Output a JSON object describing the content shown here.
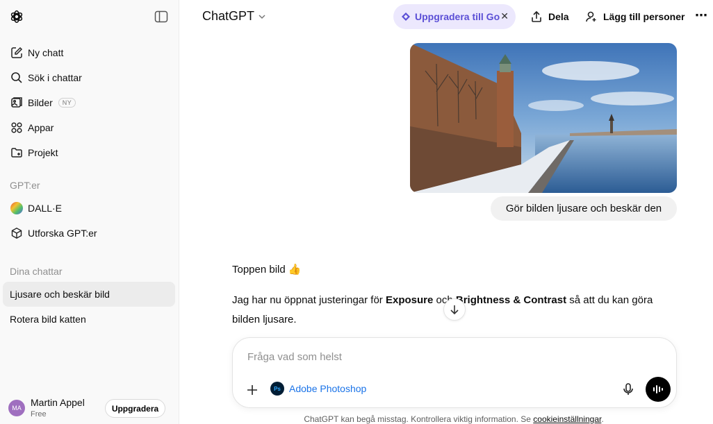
{
  "sidebar": {
    "items": [
      {
        "label": "Ny chatt",
        "icon": "new-chat-icon"
      },
      {
        "label": "Sök i chattar",
        "icon": "search-icon"
      },
      {
        "label": "Bilder",
        "icon": "images-icon",
        "badge": "NY"
      },
      {
        "label": "Appar",
        "icon": "apps-icon"
      },
      {
        "label": "Projekt",
        "icon": "folder-plus-icon"
      }
    ],
    "gpts_heading": "GPT:er",
    "gpts": [
      {
        "label": "DALL·E",
        "icon": "dalle-icon"
      },
      {
        "label": "Utforska GPT:er",
        "icon": "cube-icon"
      }
    ],
    "chats_heading": "Dina chattar",
    "chats": [
      {
        "label": "Ljusare och beskär bild",
        "active": true
      },
      {
        "label": "Rotera bild katten",
        "active": false
      }
    ],
    "user": {
      "initials": "MA",
      "name": "Martin Appel",
      "plan": "Free",
      "upgrade_label": "Uppgradera"
    }
  },
  "header": {
    "model": "ChatGPT",
    "upgrade_pill": "Uppgradera till Go",
    "share": "Dela",
    "add_people": "Lägg till personer",
    "more": "⋯"
  },
  "conversation": {
    "user_message": "Gör bilden ljusare och beskär den",
    "assistant_intro": "Toppen bild 👍",
    "assistant_text": {
      "part1": "Jag har nu öppnat justeringar för ",
      "bold1": "Exposure",
      "part2": " och ",
      "bold2": "Brightness & Contrast",
      "part3": " så att du kan göra",
      "line2": "bilden ljusare."
    }
  },
  "composer": {
    "placeholder": "Fråga vad som helst",
    "tool_label": "Adobe Photoshop",
    "tool_icon_text": "Ps"
  },
  "footer": {
    "disclaimer": "ChatGPT kan begå misstag. Kontrollera viktig information. Se ",
    "link": "cookieinställningar",
    "end": "."
  },
  "colors": {
    "accent": "#5b4fd6",
    "pill_bg": "#ece8fd",
    "sidebar_bg": "#f9f9f9",
    "link": "#1a73e8"
  }
}
